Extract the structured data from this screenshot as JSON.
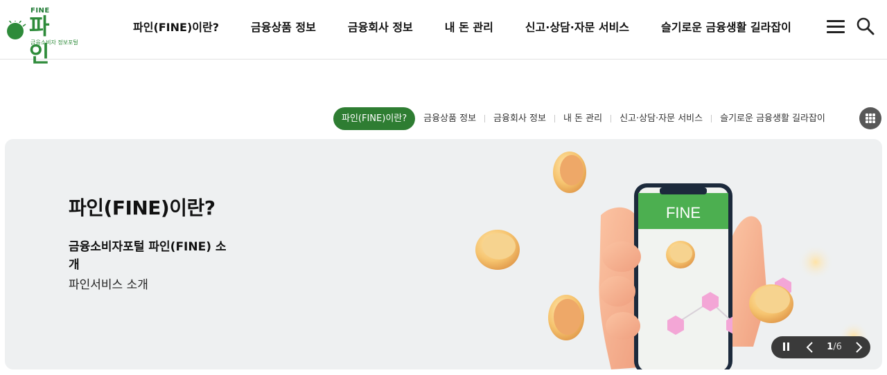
{
  "header": {
    "logo": {
      "top_text": "FINE",
      "name": "파 인",
      "subtitle": "금융소비자 정보포털"
    },
    "nav": [
      "파인(FINE)이란?",
      "금융상품 정보",
      "금융회사 정보",
      "내 돈 관리",
      "신고·상담·자문 서비스",
      "슬기로운 금융생활 길라잡이"
    ],
    "menu_icon": "hamburger-icon",
    "search_icon": "search-icon"
  },
  "subnav": {
    "active": "파인(FINE)이란?",
    "items": [
      "금융상품 정보",
      "금융회사 정보",
      "내 돈 관리",
      "신고·상담·자문 서비스",
      "슬기로운 금융생활 길라잡이"
    ],
    "grid_icon": "grid-menu-icon"
  },
  "hero": {
    "title": "파인(FINE)이란?",
    "description": "금융소비자포털 파인(FINE) 소개",
    "link": "파인서비스 소개",
    "phone_label": "FINE",
    "slider": {
      "current": "1",
      "separator": "/",
      "total": "6"
    }
  },
  "colors": {
    "brand_green": "#2e7d32",
    "hero_bg": "#eef0f1",
    "phone_header": "#4caf50"
  }
}
